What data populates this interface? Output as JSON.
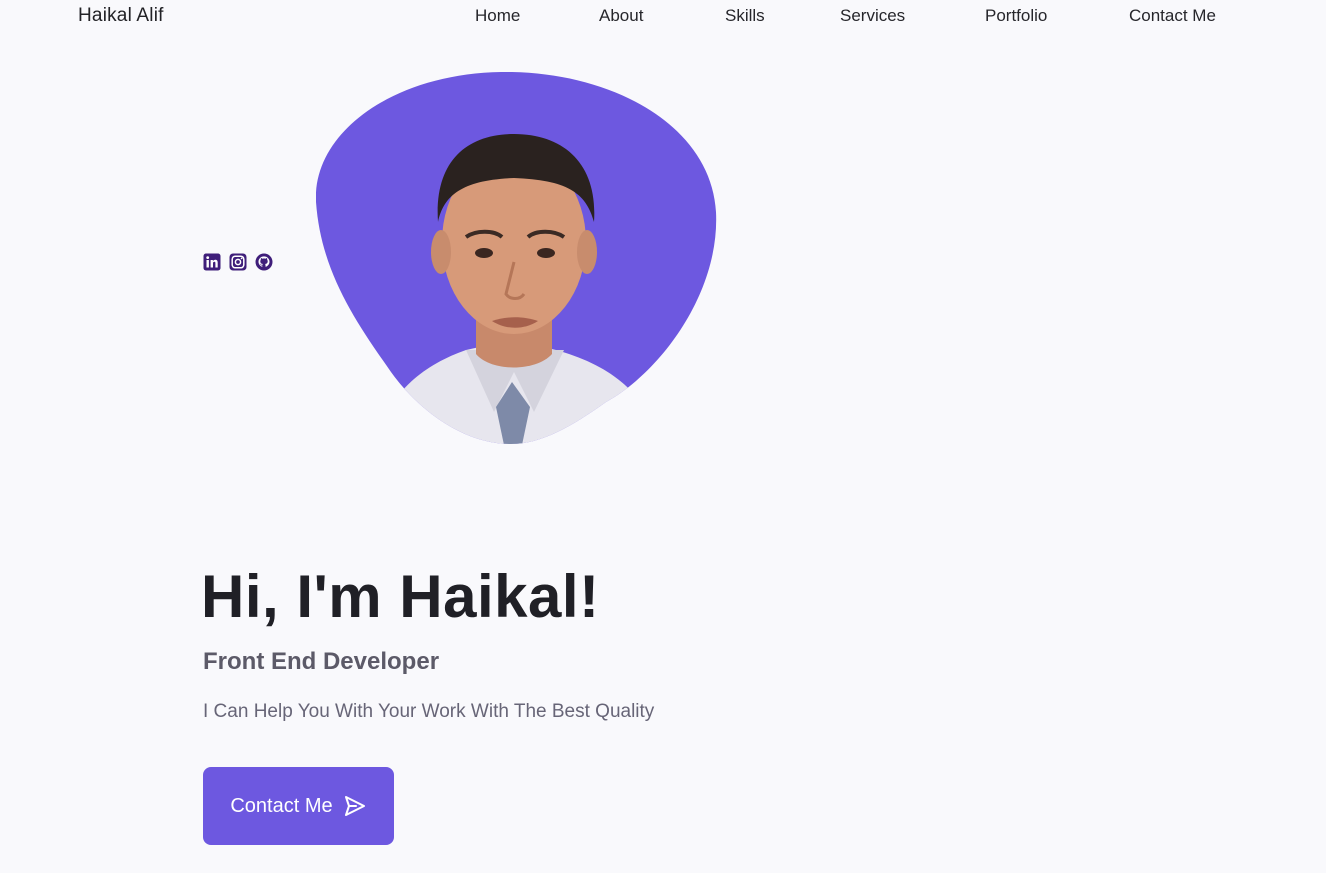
{
  "header": {
    "brand": "Haikal Alif",
    "nav": [
      {
        "label": "Home",
        "icon": "home"
      },
      {
        "label": "About",
        "icon": "user"
      },
      {
        "label": "Skills",
        "icon": "file"
      },
      {
        "label": "Services",
        "icon": "briefcase"
      },
      {
        "label": "Portfolio",
        "icon": "image"
      },
      {
        "label": "Contact Me",
        "icon": "message"
      }
    ]
  },
  "hero": {
    "social_icons": [
      "linkedin-icon",
      "instagram-icon",
      "github-icon"
    ],
    "profile_blob_color": "#6d58e0",
    "title": "Hi, I'm Haikal!",
    "subtitle": "Front End Developer",
    "description": "I Can Help You With Your Work With The Best Quality",
    "cta_label": "Contact Me",
    "cta_icon": "send-icon"
  },
  "colors": {
    "accent": "#6d58e0",
    "social_icon": "#3f1e7a",
    "background": "#f9f9fc"
  }
}
